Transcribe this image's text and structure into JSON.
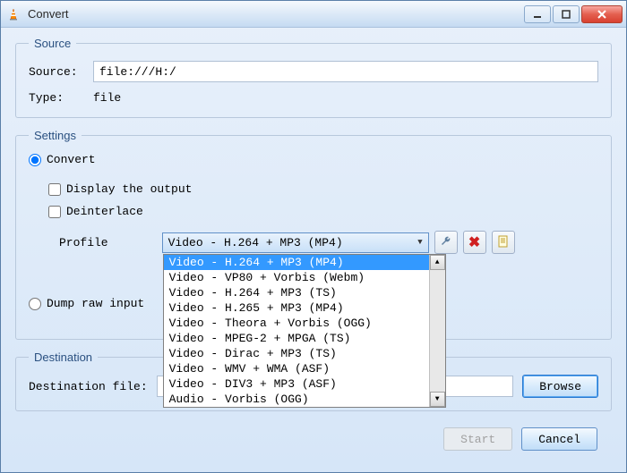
{
  "window": {
    "title": "Convert"
  },
  "source": {
    "legend": "Source",
    "source_label": "Source:",
    "source_value": "file:///H:/",
    "type_label": "Type:",
    "type_value": "file"
  },
  "settings": {
    "legend": "Settings",
    "convert_label": "Convert",
    "display_output_label": "Display the output",
    "deinterlace_label": "Deinterlace",
    "profile_label": "Profile",
    "profile_selected": "Video - H.264 + MP3 (MP4)",
    "profile_options": [
      "Video - H.264 + MP3 (MP4)",
      "Video - VP80 + Vorbis (Webm)",
      "Video - H.264 + MP3 (TS)",
      "Video - H.265 + MP3 (MP4)",
      "Video - Theora + Vorbis (OGG)",
      "Video - MPEG-2 + MPGA (TS)",
      "Video - Dirac + MP3 (TS)",
      "Video - WMV + WMA (ASF)",
      "Video - DIV3 + MP3 (ASF)",
      "Audio - Vorbis (OGG)"
    ],
    "dump_label": "Dump raw input"
  },
  "destination": {
    "legend": "Destination",
    "file_label": "Destination file:",
    "file_value": "",
    "browse_label": "Browse"
  },
  "buttons": {
    "start": "Start",
    "cancel": "Cancel"
  }
}
